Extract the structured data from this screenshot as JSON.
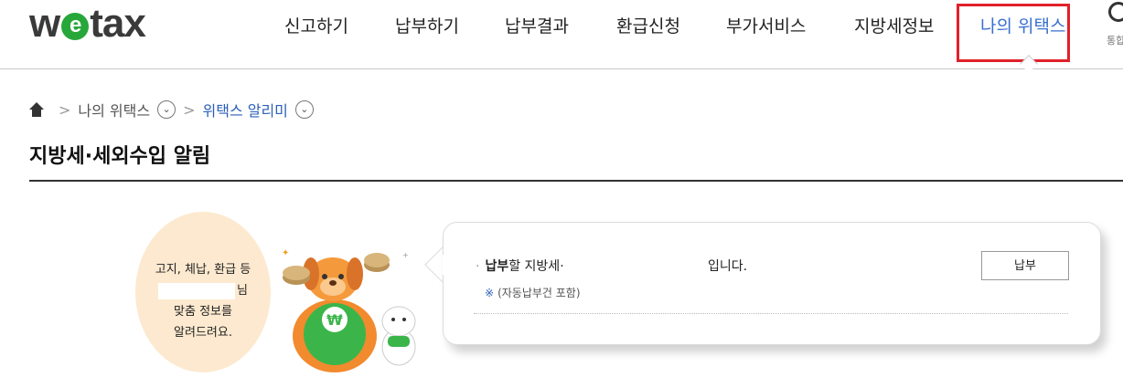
{
  "header": {
    "logo_prefix": "w",
    "logo_e": "e",
    "logo_suffix": "tax",
    "nav": [
      {
        "label": "신고하기"
      },
      {
        "label": "납부하기"
      },
      {
        "label": "납부결과"
      },
      {
        "label": "환급신청"
      },
      {
        "label": "부가서비스"
      },
      {
        "label": "지방세정보"
      },
      {
        "label": "나의 위택스",
        "active": true
      }
    ],
    "right_label": "통합",
    "accent_color": "#3a6fd0",
    "highlight_color": "#e0202a"
  },
  "breadcrumb": {
    "home_icon": "home-icon",
    "items": [
      {
        "label": "나의 위택스"
      },
      {
        "label": "위택스 알리미"
      }
    ]
  },
  "page": {
    "title": "지방세·세외수입 알림"
  },
  "promo": {
    "line1": "고지, 체납, 환급 등",
    "name_suffix": "님",
    "line3": "맞춤 정보를",
    "line4": "알려드려요.",
    "bg_color": "#fde9cf"
  },
  "notice": {
    "emphasis": "납부",
    "text": "할 지방세·",
    "ending": "입니다.",
    "note_mark": "※",
    "note": "(자동납부건 포함)",
    "pay_button": "납부"
  }
}
